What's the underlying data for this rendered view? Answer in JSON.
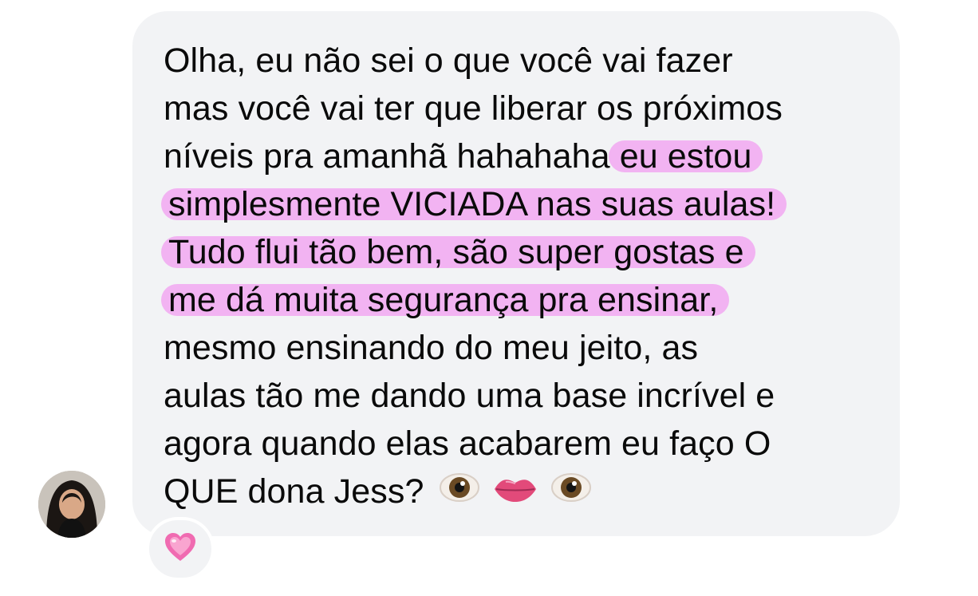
{
  "message": {
    "lines": [
      "Olha, eu não sei o que você vai fazer",
      "mas você vai ter que liberar os próximos",
      "níveis pra amanhã hahahaha",
      "simplesmente VICIADA nas suas aulas!",
      "Tudo flui tão bem, são super gostas e",
      "me dá muita segurança pra ensinar,",
      "mesmo ensinando do meu jeito, as",
      "aulas tão me dando uma base incrível e",
      "agora quando elas acabarem eu faço O",
      "QUE dona Jess?"
    ],
    "highlight_start": "eu estou",
    "emojis": [
      "eye-icon",
      "lips-icon",
      "eye-icon"
    ]
  },
  "reaction": {
    "icon": "heart-icon"
  },
  "colors": {
    "bubble": "#f2f3f5",
    "highlight": "#f2b3f2",
    "text": "#0a0a0a"
  }
}
